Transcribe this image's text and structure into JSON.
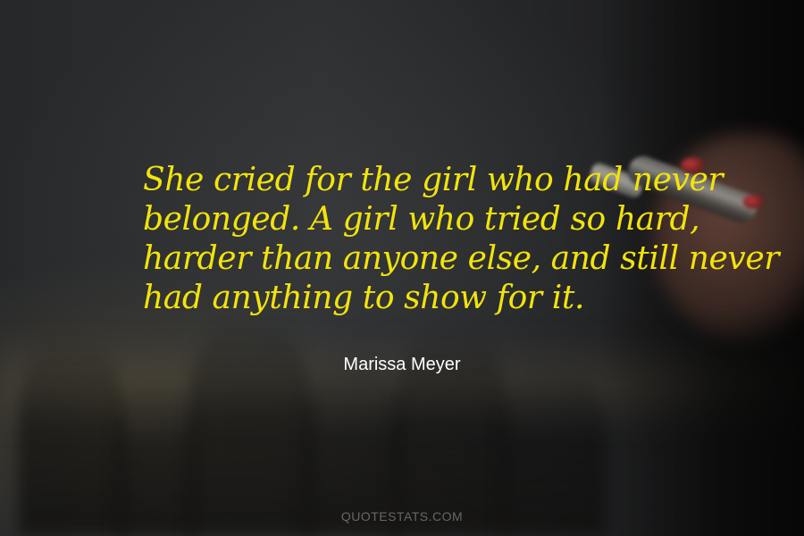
{
  "quote": {
    "lines": [
      "She cried for the girl who had never",
      "belonged. A girl who tried so hard,",
      "harder than anyone else, and still never",
      "had anything to show for it."
    ]
  },
  "author": "Marissa Meyer",
  "watermark": "QUOTESTATS.COM",
  "colors": {
    "quote_text": "#f2e30c",
    "author_text": "#ffffff",
    "watermark_text": "#aaaaaa",
    "background": "#26282a"
  }
}
